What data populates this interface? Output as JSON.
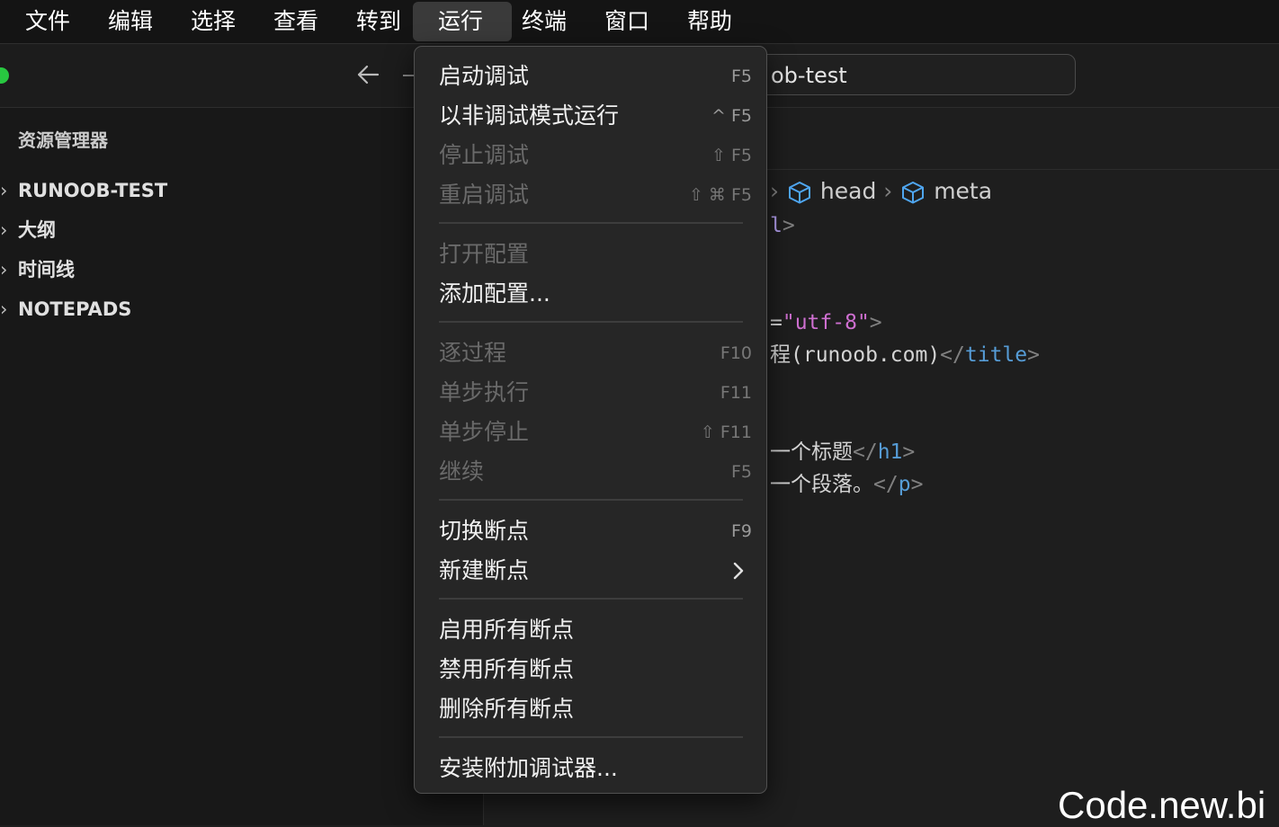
{
  "menubar": {
    "items": [
      "文件",
      "编辑",
      "选择",
      "查看",
      "转到",
      "运行",
      "终端",
      "窗口",
      "帮助"
    ],
    "active_index": 5
  },
  "titlebar": {
    "search_text": "ob-test"
  },
  "sidebar": {
    "title": "资源管理器",
    "items": [
      "RUNOOB-TEST",
      "大纲",
      "时间线",
      "NOTEPADS"
    ]
  },
  "editor": {
    "breadcrumb": [
      "head",
      "meta"
    ],
    "code": {
      "line1_tail": "l",
      "line1_close": ">",
      "line2_eq": "=",
      "line2_str": "\"utf-8\"",
      "line2_close": ">",
      "line3_text": "程(runoob.com)",
      "line3_open": "</",
      "line3_tag": "title",
      "line3_close": ">",
      "line4_text": "一个标题",
      "line4_open": "</",
      "line4_tag": "h1",
      "line4_close": ">",
      "line5_text": "一个段落。",
      "line5_open": "</",
      "line5_tag": "p",
      "line5_close": ">"
    }
  },
  "run_menu": {
    "items": [
      {
        "label": "启动调试",
        "shortcut": "F5",
        "disabled": false
      },
      {
        "label": "以非调试模式运行",
        "shortcut": "^ F5",
        "disabled": false
      },
      {
        "label": "停止调试",
        "shortcut": "⇧ F5",
        "disabled": true
      },
      {
        "label": "重启调试",
        "shortcut": "⇧ ⌘ F5",
        "disabled": true
      },
      {
        "label": "打开配置",
        "shortcut": "",
        "disabled": true
      },
      {
        "label": "添加配置...",
        "shortcut": "",
        "disabled": false
      },
      {
        "label": "逐过程",
        "shortcut": "F10",
        "disabled": true
      },
      {
        "label": "单步执行",
        "shortcut": "F11",
        "disabled": true
      },
      {
        "label": "单步停止",
        "shortcut": "⇧ F11",
        "disabled": true
      },
      {
        "label": "继续",
        "shortcut": "F5",
        "disabled": true
      },
      {
        "label": "切换断点",
        "shortcut": "F9",
        "disabled": false
      },
      {
        "label": "新建断点",
        "shortcut": "",
        "disabled": false,
        "submenu": true
      },
      {
        "label": "启用所有断点",
        "shortcut": "",
        "disabled": false
      },
      {
        "label": "禁用所有断点",
        "shortcut": "",
        "disabled": false
      },
      {
        "label": "删除所有断点",
        "shortcut": "",
        "disabled": false
      },
      {
        "label": "安装附加调试器...",
        "shortcut": "",
        "disabled": false
      }
    ]
  },
  "watermark": "Code.new.bi",
  "colors": {
    "menu_active_bg": "#3a3a3a",
    "traffic_green": "#28c840",
    "tag_blue": "#569cd6",
    "string_pink": "#ce6fd0"
  }
}
